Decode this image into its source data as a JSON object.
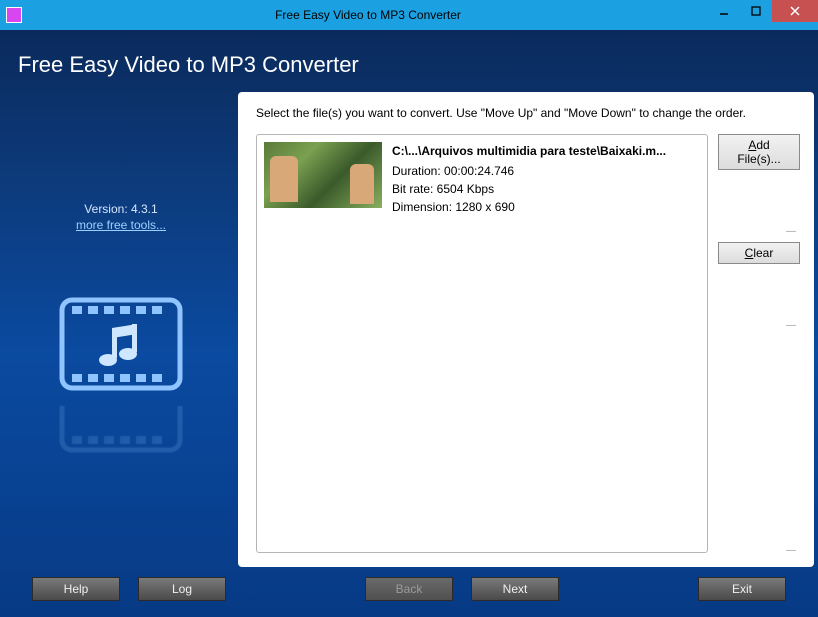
{
  "titlebar": {
    "title": "Free Easy Video to MP3 Converter"
  },
  "app": {
    "title": "Free Easy Video to MP3 Converter"
  },
  "sidebar": {
    "version_label": "Version: 4.3.1",
    "more_tools": "more free tools..."
  },
  "panel": {
    "instruction": "Select the file(s) you want to convert. Use \"Move Up\" and \"Move Down\" to change the order."
  },
  "file": {
    "path": "C:\\...\\Arquivos multimidia para teste\\Baixaki.m...",
    "duration_label": "Duration: 00:00:24.746",
    "bitrate_label": "Bit rate: 6504 Kbps",
    "dimension_label": "Dimension: 1280 x 690"
  },
  "buttons": {
    "add_files": "Add File(s)...",
    "clear": "Clear",
    "help": "Help",
    "log": "Log",
    "back": "Back",
    "next": "Next",
    "exit": "Exit"
  }
}
